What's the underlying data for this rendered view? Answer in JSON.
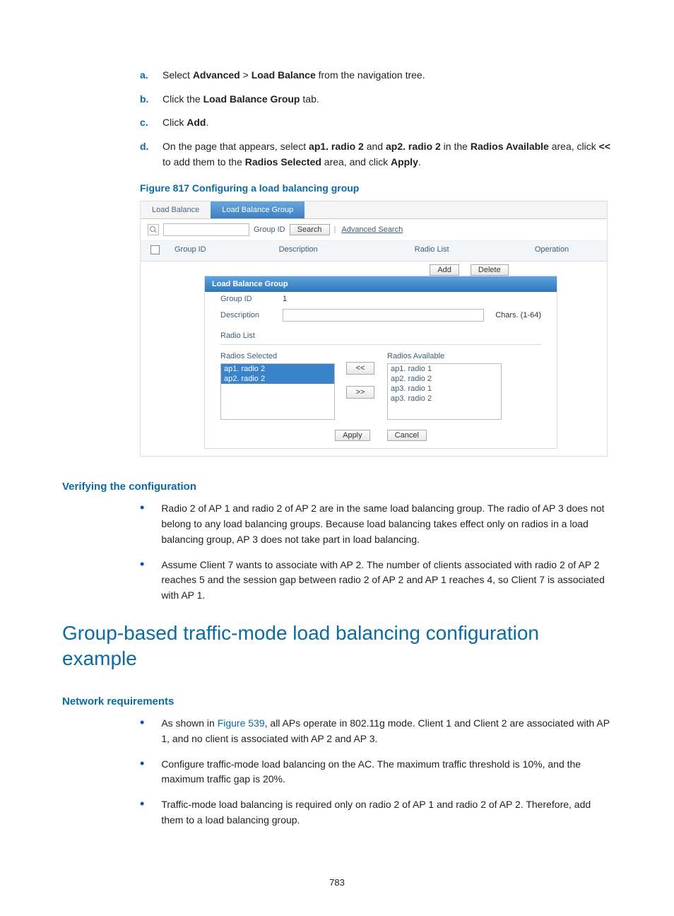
{
  "steps": [
    {
      "letter": "a.",
      "html": "Select <b>Advanced</b> > <b>Load Balance</b> from the navigation tree."
    },
    {
      "letter": "b.",
      "html": "Click the <b>Load Balance Group</b> tab."
    },
    {
      "letter": "c.",
      "html": "Click <b>Add</b>."
    },
    {
      "letter": "d.",
      "html": "On the page that appears, select <b>ap1. radio 2</b> and <b>ap2. radio 2</b> in the <b>Radios Available</b> area, click <b>&lt;&lt;</b> to add them to the <b>Radios Selected</b> area, and click <b>Apply</b>."
    }
  ],
  "figure_caption": "Figure 817 Configuring a load balancing group",
  "ui": {
    "tabs": {
      "inactive": "Load Balance",
      "active": "Load Balance Group"
    },
    "search": {
      "field_label": "Group ID",
      "search_btn": "Search",
      "advanced": "Advanced Search"
    },
    "grid_headers": {
      "group_id": "Group ID",
      "description": "Description",
      "radio_list": "Radio List",
      "operation": "Operation"
    },
    "top_buttons": {
      "add": "Add",
      "delete": "Delete"
    },
    "panel_title": "Load Balance Group",
    "form": {
      "group_id_label": "Group ID",
      "group_id_value": "1",
      "description_label": "Description",
      "chars_hint": "Chars. (1-64)",
      "radio_list_label": "Radio List",
      "selected_label": "Radios Selected",
      "available_label": "Radios Available",
      "selected": [
        "ap1. radio 2",
        "ap2. radio 2"
      ],
      "available": [
        "ap1. radio 1",
        "ap2. radio 2",
        "ap3. radio 1",
        "ap3. radio 2"
      ],
      "move_left": "<<",
      "move_right": ">>",
      "apply": "Apply",
      "cancel": "Cancel"
    }
  },
  "verify_heading": "Verifying the configuration",
  "verify_bullets": [
    "Radio 2 of AP 1 and radio 2 of AP 2 are in the same load balancing group. The radio of AP 3 does not belong to any load balancing groups. Because load balancing takes effect only on radios in a load balancing group, AP 3 does not take part in load balancing.",
    "Assume Client 7 wants to associate with AP 2. The number of clients associated with radio 2 of AP 2 reaches 5 and the session gap between radio 2 of AP 2 and AP 1 reaches 4, so Client 7 is associated with AP 1."
  ],
  "h1": "Group-based traffic-mode load balancing configuration example",
  "netreq_heading": "Network requirements",
  "netreq_bullets": [
    {
      "html": "As shown in <span class='link'>Figure 539</span>, all APs operate in 802.11g mode. Client 1 and Client 2 are associated with AP 1, and no client is associated with AP 2 and AP 3."
    },
    {
      "html": "Configure traffic-mode load balancing on the AC. The maximum traffic threshold is 10%, and the maximum traffic gap is 20%."
    },
    {
      "html": "Traffic-mode load balancing is required only on radio 2 of AP 1 and radio 2 of AP 2. Therefore, add them to a load balancing group."
    }
  ],
  "page_number": "783"
}
